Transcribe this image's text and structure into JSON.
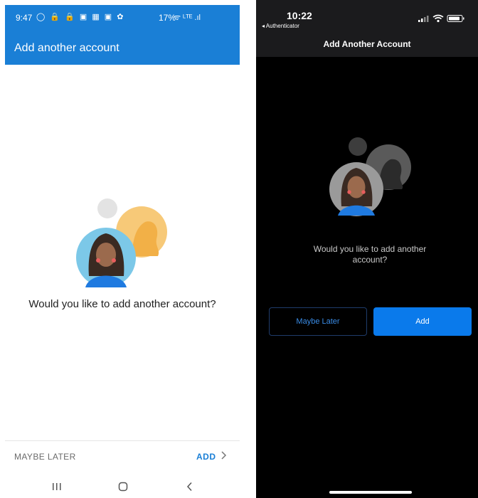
{
  "android": {
    "status": {
      "time": "9:47",
      "notification_icons": "◯ 🔒 🔒 ▣ ▦ ▣ ✿",
      "signal_text": "ᯤ ᴸᵀᴱ .ıl",
      "battery": "17%"
    },
    "appbar": {
      "title": "Add another account"
    },
    "illustration": {
      "name": "user-avatars-illustration"
    },
    "question": "Would you like to add another account?",
    "actions": {
      "maybe_later": "MAYBE LATER",
      "add": "ADD"
    },
    "colors": {
      "primary": "#1a7fd6",
      "avatar_bg": "#7cc8e8",
      "silhouette_bg": "#f7c978"
    }
  },
  "ios": {
    "status": {
      "time": "10:22",
      "back_app": "◂ Authenticator"
    },
    "nav": {
      "title": "Add Another Account"
    },
    "question": "Would you like to add another account?",
    "actions": {
      "maybe_later": "Maybe Later",
      "add": "Add"
    },
    "colors": {
      "accent": "#0a7aeb",
      "background": "#000000"
    }
  }
}
